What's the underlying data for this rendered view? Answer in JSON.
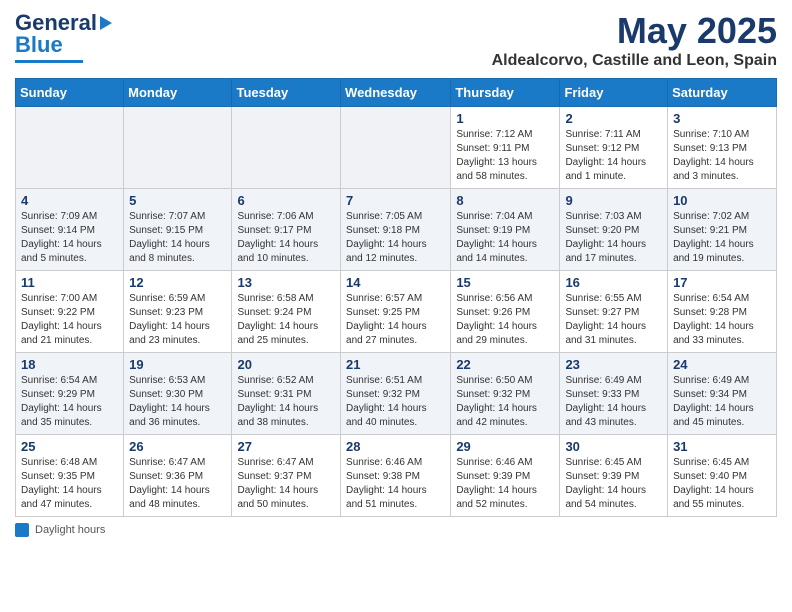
{
  "header": {
    "logo_line1": "General",
    "logo_line2": "Blue",
    "title": "May 2025",
    "subtitle": "Aldealcorvo, Castille and Leon, Spain"
  },
  "weekdays": [
    "Sunday",
    "Monday",
    "Tuesday",
    "Wednesday",
    "Thursday",
    "Friday",
    "Saturday"
  ],
  "weeks": [
    [
      {
        "day": "",
        "info": ""
      },
      {
        "day": "",
        "info": ""
      },
      {
        "day": "",
        "info": ""
      },
      {
        "day": "",
        "info": ""
      },
      {
        "day": "1",
        "info": "Sunrise: 7:12 AM\nSunset: 9:11 PM\nDaylight: 13 hours\nand 58 minutes."
      },
      {
        "day": "2",
        "info": "Sunrise: 7:11 AM\nSunset: 9:12 PM\nDaylight: 14 hours\nand 1 minute."
      },
      {
        "day": "3",
        "info": "Sunrise: 7:10 AM\nSunset: 9:13 PM\nDaylight: 14 hours\nand 3 minutes."
      }
    ],
    [
      {
        "day": "4",
        "info": "Sunrise: 7:09 AM\nSunset: 9:14 PM\nDaylight: 14 hours\nand 5 minutes."
      },
      {
        "day": "5",
        "info": "Sunrise: 7:07 AM\nSunset: 9:15 PM\nDaylight: 14 hours\nand 8 minutes."
      },
      {
        "day": "6",
        "info": "Sunrise: 7:06 AM\nSunset: 9:17 PM\nDaylight: 14 hours\nand 10 minutes."
      },
      {
        "day": "7",
        "info": "Sunrise: 7:05 AM\nSunset: 9:18 PM\nDaylight: 14 hours\nand 12 minutes."
      },
      {
        "day": "8",
        "info": "Sunrise: 7:04 AM\nSunset: 9:19 PM\nDaylight: 14 hours\nand 14 minutes."
      },
      {
        "day": "9",
        "info": "Sunrise: 7:03 AM\nSunset: 9:20 PM\nDaylight: 14 hours\nand 17 minutes."
      },
      {
        "day": "10",
        "info": "Sunrise: 7:02 AM\nSunset: 9:21 PM\nDaylight: 14 hours\nand 19 minutes."
      }
    ],
    [
      {
        "day": "11",
        "info": "Sunrise: 7:00 AM\nSunset: 9:22 PM\nDaylight: 14 hours\nand 21 minutes."
      },
      {
        "day": "12",
        "info": "Sunrise: 6:59 AM\nSunset: 9:23 PM\nDaylight: 14 hours\nand 23 minutes."
      },
      {
        "day": "13",
        "info": "Sunrise: 6:58 AM\nSunset: 9:24 PM\nDaylight: 14 hours\nand 25 minutes."
      },
      {
        "day": "14",
        "info": "Sunrise: 6:57 AM\nSunset: 9:25 PM\nDaylight: 14 hours\nand 27 minutes."
      },
      {
        "day": "15",
        "info": "Sunrise: 6:56 AM\nSunset: 9:26 PM\nDaylight: 14 hours\nand 29 minutes."
      },
      {
        "day": "16",
        "info": "Sunrise: 6:55 AM\nSunset: 9:27 PM\nDaylight: 14 hours\nand 31 minutes."
      },
      {
        "day": "17",
        "info": "Sunrise: 6:54 AM\nSunset: 9:28 PM\nDaylight: 14 hours\nand 33 minutes."
      }
    ],
    [
      {
        "day": "18",
        "info": "Sunrise: 6:54 AM\nSunset: 9:29 PM\nDaylight: 14 hours\nand 35 minutes."
      },
      {
        "day": "19",
        "info": "Sunrise: 6:53 AM\nSunset: 9:30 PM\nDaylight: 14 hours\nand 36 minutes."
      },
      {
        "day": "20",
        "info": "Sunrise: 6:52 AM\nSunset: 9:31 PM\nDaylight: 14 hours\nand 38 minutes."
      },
      {
        "day": "21",
        "info": "Sunrise: 6:51 AM\nSunset: 9:32 PM\nDaylight: 14 hours\nand 40 minutes."
      },
      {
        "day": "22",
        "info": "Sunrise: 6:50 AM\nSunset: 9:32 PM\nDaylight: 14 hours\nand 42 minutes."
      },
      {
        "day": "23",
        "info": "Sunrise: 6:49 AM\nSunset: 9:33 PM\nDaylight: 14 hours\nand 43 minutes."
      },
      {
        "day": "24",
        "info": "Sunrise: 6:49 AM\nSunset: 9:34 PM\nDaylight: 14 hours\nand 45 minutes."
      }
    ],
    [
      {
        "day": "25",
        "info": "Sunrise: 6:48 AM\nSunset: 9:35 PM\nDaylight: 14 hours\nand 47 minutes."
      },
      {
        "day": "26",
        "info": "Sunrise: 6:47 AM\nSunset: 9:36 PM\nDaylight: 14 hours\nand 48 minutes."
      },
      {
        "day": "27",
        "info": "Sunrise: 6:47 AM\nSunset: 9:37 PM\nDaylight: 14 hours\nand 50 minutes."
      },
      {
        "day": "28",
        "info": "Sunrise: 6:46 AM\nSunset: 9:38 PM\nDaylight: 14 hours\nand 51 minutes."
      },
      {
        "day": "29",
        "info": "Sunrise: 6:46 AM\nSunset: 9:39 PM\nDaylight: 14 hours\nand 52 minutes."
      },
      {
        "day": "30",
        "info": "Sunrise: 6:45 AM\nSunset: 9:39 PM\nDaylight: 14 hours\nand 54 minutes."
      },
      {
        "day": "31",
        "info": "Sunrise: 6:45 AM\nSunset: 9:40 PM\nDaylight: 14 hours\nand 55 minutes."
      }
    ]
  ],
  "legend": {
    "daylight_hours": "Daylight hours"
  }
}
